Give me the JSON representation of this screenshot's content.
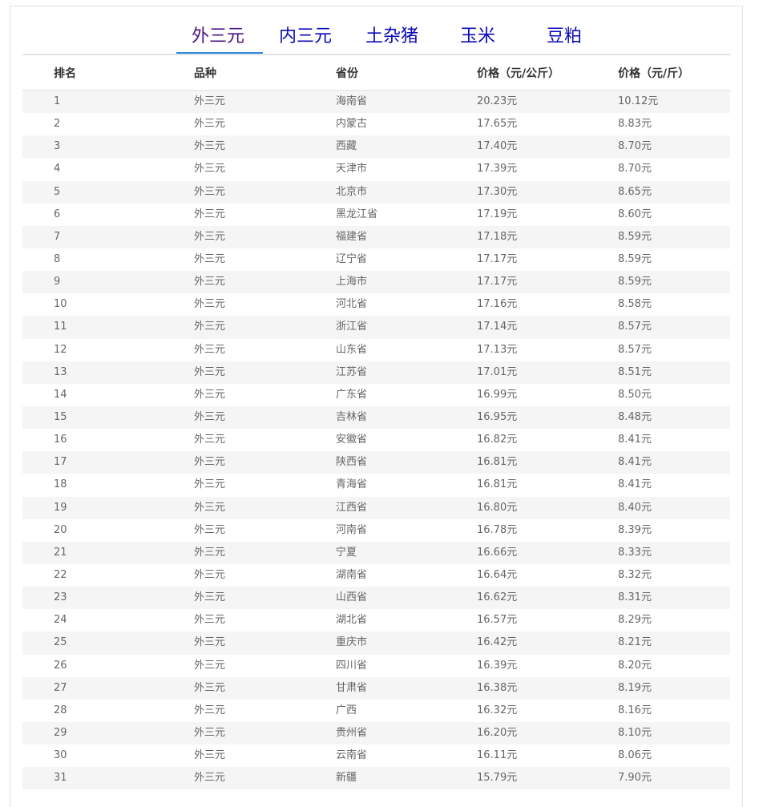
{
  "tabs": [
    {
      "label": "外三元",
      "active": true
    },
    {
      "label": "内三元",
      "active": false
    },
    {
      "label": "土杂猪",
      "active": false
    },
    {
      "label": "玉米",
      "active": false
    },
    {
      "label": "豆粕",
      "active": false
    }
  ],
  "columns": [
    "排名",
    "品种",
    "省份",
    "价格（元/公斤）",
    "价格（元/斤）"
  ],
  "rows": [
    [
      "1",
      "外三元",
      "海南省",
      "20.23元",
      "10.12元"
    ],
    [
      "2",
      "外三元",
      "内蒙古",
      "17.65元",
      "8.83元"
    ],
    [
      "3",
      "外三元",
      "西藏",
      "17.40元",
      "8.70元"
    ],
    [
      "4",
      "外三元",
      "天津市",
      "17.39元",
      "8.70元"
    ],
    [
      "5",
      "外三元",
      "北京市",
      "17.30元",
      "8.65元"
    ],
    [
      "6",
      "外三元",
      "黑龙江省",
      "17.19元",
      "8.60元"
    ],
    [
      "7",
      "外三元",
      "福建省",
      "17.18元",
      "8.59元"
    ],
    [
      "8",
      "外三元",
      "辽宁省",
      "17.17元",
      "8.59元"
    ],
    [
      "9",
      "外三元",
      "上海市",
      "17.17元",
      "8.59元"
    ],
    [
      "10",
      "外三元",
      "河北省",
      "17.16元",
      "8.58元"
    ],
    [
      "11",
      "外三元",
      "浙江省",
      "17.14元",
      "8.57元"
    ],
    [
      "12",
      "外三元",
      "山东省",
      "17.13元",
      "8.57元"
    ],
    [
      "13",
      "外三元",
      "江苏省",
      "17.01元",
      "8.51元"
    ],
    [
      "14",
      "外三元",
      "广东省",
      "16.99元",
      "8.50元"
    ],
    [
      "15",
      "外三元",
      "吉林省",
      "16.95元",
      "8.48元"
    ],
    [
      "16",
      "外三元",
      "安徽省",
      "16.82元",
      "8.41元"
    ],
    [
      "17",
      "外三元",
      "陕西省",
      "16.81元",
      "8.41元"
    ],
    [
      "18",
      "外三元",
      "青海省",
      "16.81元",
      "8.41元"
    ],
    [
      "19",
      "外三元",
      "江西省",
      "16.80元",
      "8.40元"
    ],
    [
      "20",
      "外三元",
      "河南省",
      "16.78元",
      "8.39元"
    ],
    [
      "21",
      "外三元",
      "宁夏",
      "16.66元",
      "8.33元"
    ],
    [
      "22",
      "外三元",
      "湖南省",
      "16.64元",
      "8.32元"
    ],
    [
      "23",
      "外三元",
      "山西省",
      "16.62元",
      "8.31元"
    ],
    [
      "24",
      "外三元",
      "湖北省",
      "16.57元",
      "8.29元"
    ],
    [
      "25",
      "外三元",
      "重庆市",
      "16.42元",
      "8.21元"
    ],
    [
      "26",
      "外三元",
      "四川省",
      "16.39元",
      "8.20元"
    ],
    [
      "27",
      "外三元",
      "甘肃省",
      "16.38元",
      "8.19元"
    ],
    [
      "28",
      "外三元",
      "广西",
      "16.32元",
      "8.16元"
    ],
    [
      "29",
      "外三元",
      "贵州省",
      "16.20元",
      "8.10元"
    ],
    [
      "30",
      "外三元",
      "云南省",
      "16.11元",
      "8.06元"
    ],
    [
      "31",
      "外三元",
      "新疆",
      "15.79元",
      "7.90元"
    ]
  ]
}
